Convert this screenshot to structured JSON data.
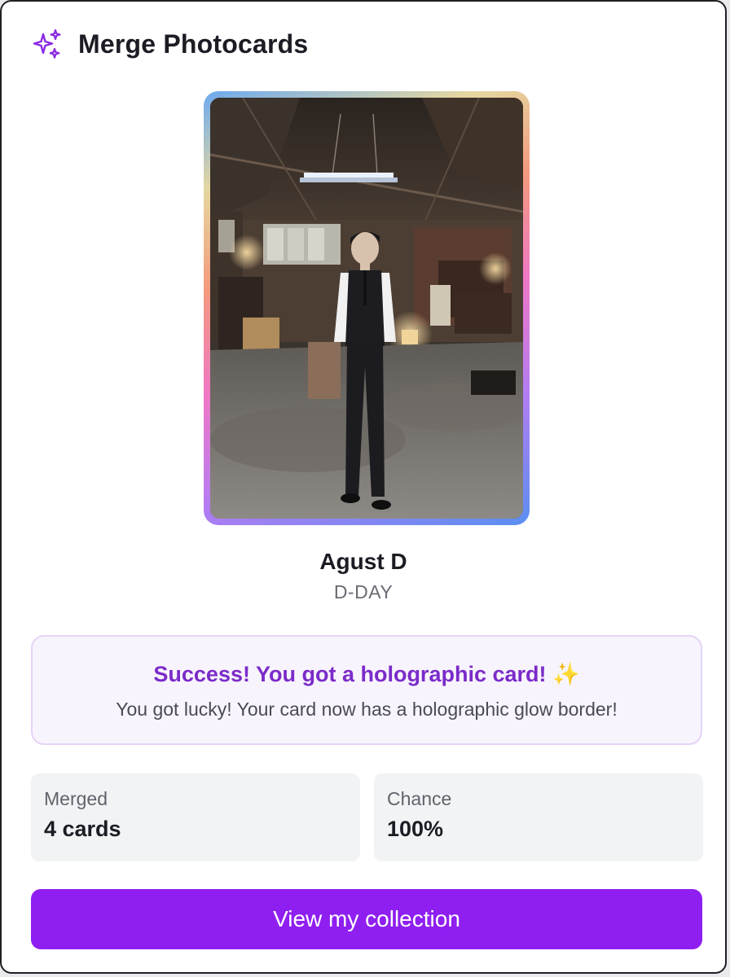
{
  "header": {
    "icon": "sparkles-icon",
    "title": "Merge Photocards"
  },
  "card": {
    "border_style": "holographic",
    "artist": "Agust D",
    "album": "D-DAY"
  },
  "result": {
    "title": "Success! You got a holographic card! ✨",
    "message": "You got lucky! Your card now has a holographic glow border!"
  },
  "stats": {
    "merged_label": "Merged",
    "merged_value": "4 cards",
    "chance_label": "Chance",
    "chance_value": "100%"
  },
  "actions": {
    "view_collection": "View my collection"
  },
  "colors": {
    "accent": "#8f1ff0",
    "success_text": "#7b2bc9",
    "success_bg": "#f8f4fd"
  }
}
